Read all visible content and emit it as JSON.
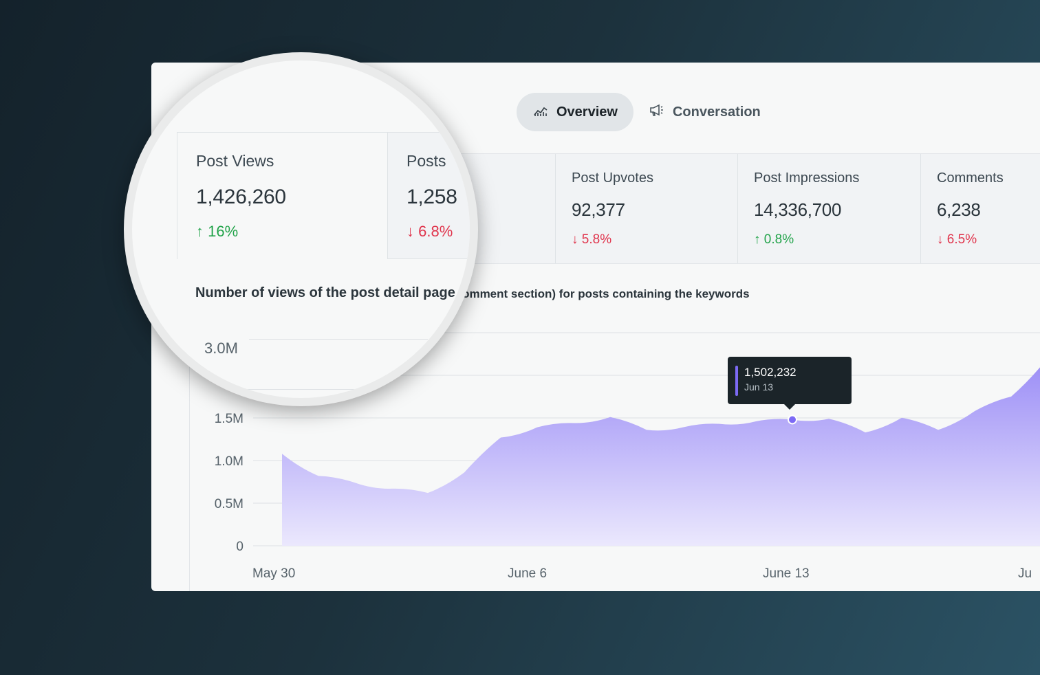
{
  "tabs": [
    {
      "label": "Overview",
      "icon": "chart-icon",
      "active": true
    },
    {
      "label": "Conversation",
      "icon": "megaphone-icon",
      "active": false
    }
  ],
  "metrics": [
    {
      "label": "Post Views",
      "value": "1,426,260",
      "change": "16%",
      "direction": "up"
    },
    {
      "label": "Posts",
      "value": "1,258",
      "change": "6.8%",
      "direction": "down"
    },
    {
      "label": "Post Upvotes",
      "value": "92,377",
      "change": "5.8%",
      "direction": "down"
    },
    {
      "label": "Post Impressions",
      "value": "14,336,700",
      "change": "0.8%",
      "direction": "up"
    },
    {
      "label": "Comments",
      "value": "6,238",
      "change": "6.5%",
      "direction": "down"
    }
  ],
  "description_magnified": "Number of views of the post detail page",
  "description_rest": "ed into comment section) for posts containing the keywords",
  "tooltip": {
    "value": "1,502,232",
    "date": "Jun 13"
  },
  "colors": {
    "accent": "#7c6af5",
    "up": "#22a34a",
    "down": "#e0344c"
  },
  "chart_data": {
    "type": "area",
    "y_ticks": [
      "0",
      "0.5M",
      "1.0M",
      "1.5M",
      "3.0M"
    ],
    "x_ticks": [
      "May 30",
      "June 6",
      "June 13",
      "Ju"
    ],
    "ylim": [
      0,
      3000000
    ],
    "x": [
      "May 30",
      "May 31",
      "Jun 1",
      "Jun 2",
      "Jun 3",
      "Jun 4",
      "Jun 5",
      "Jun 6",
      "Jun 7",
      "Jun 8",
      "Jun 9",
      "Jun 10",
      "Jun 11",
      "Jun 12",
      "Jun 13",
      "Jun 14",
      "Jun 15",
      "Jun 16",
      "Jun 17",
      "Jun 18",
      "Jun 19",
      "Jun 20"
    ],
    "series": [
      {
        "values": [
          1080000,
          820000,
          740000,
          670000,
          620000,
          860000,
          1270000,
          1390000,
          1440000,
          1510000,
          1360000,
          1390000,
          1430000,
          1460000,
          1480000,
          1490000,
          1330000,
          1502232,
          1360000,
          1580000,
          1750000,
          2200000
        ]
      }
    ]
  }
}
